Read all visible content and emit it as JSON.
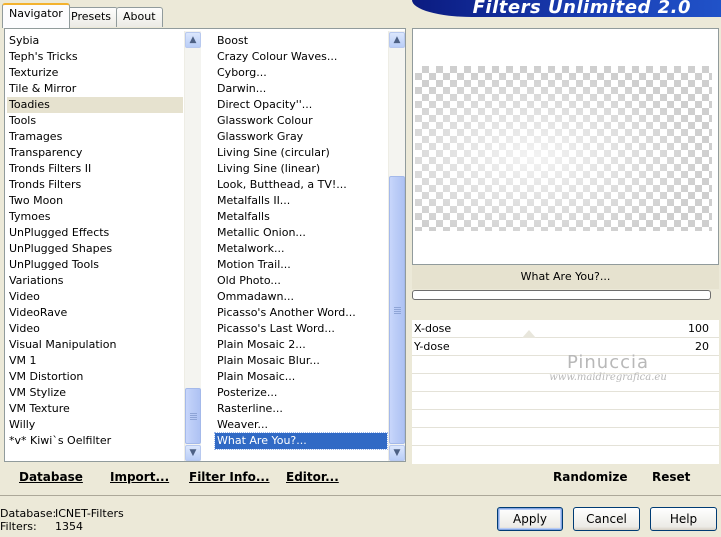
{
  "tabs": [
    "Navigator",
    "Presets",
    "About"
  ],
  "header": {
    "title": "Filters Unlimited 2.0"
  },
  "categories": [
    "Sybia",
    "Teph's Tricks",
    "Texturize",
    "Tile & Mirror",
    "Toadies",
    "Tools",
    "Tramages",
    "Transparency",
    "Tronds Filters II",
    "Tronds Filters",
    "Two Moon",
    "Tymoes",
    "UnPlugged Effects",
    "UnPlugged Shapes",
    "UnPlugged Tools",
    "Variations",
    "Video",
    "VideoRave",
    "Video",
    "Visual Manipulation",
    "VM 1",
    "VM Distortion",
    "VM Stylize",
    "VM Texture",
    "Willy",
    "*v* Kiwi`s Oelfilter"
  ],
  "selected_category": "Toadies",
  "filters": [
    "Boost",
    "Crazy Colour Waves...",
    "Cyborg...",
    "Darwin...",
    "Direct Opacity''...",
    "Glasswork Colour",
    "Glasswork Gray",
    "Living Sine (circular)",
    "Living Sine (linear)",
    "Look, Butthead, a TV!...",
    "Metalfalls II...",
    "Metalfalls",
    "Metallic Onion...",
    "Metalwork...",
    "Motion Trail...",
    "Old Photo...",
    "Ommadawn...",
    "Picasso's Another Word...",
    "Picasso's Last Word...",
    "Plain Mosaic 2...",
    "Plain Mosaic Blur...",
    "Plain Mosaic...",
    "Posterize...",
    "Rasterline...",
    "Weaver...",
    "What Are You?..."
  ],
  "selected_filter": "What Are You?...",
  "params": [
    {
      "label": "X-dose",
      "value": "100"
    },
    {
      "label": "Y-dose",
      "value": "20"
    }
  ],
  "watermark": {
    "name": "Pinuccia",
    "site": "www.maidiregrafica.eu"
  },
  "toolbar": {
    "database": "Database",
    "import": "Import...",
    "filter_info": "Filter Info...",
    "editor": "Editor...",
    "randomize": "Randomize",
    "reset": "Reset"
  },
  "footer": {
    "database_label": "Database:",
    "database_value": "ICNET-Filters",
    "filters_label": "Filters:",
    "filters_value": "1354"
  },
  "buttons": {
    "apply": "Apply",
    "cancel": "Cancel",
    "help": "Help"
  },
  "colors": {
    "selection": "#316ac5",
    "banner": "#1a3fb5",
    "window": "#ece9d8"
  }
}
